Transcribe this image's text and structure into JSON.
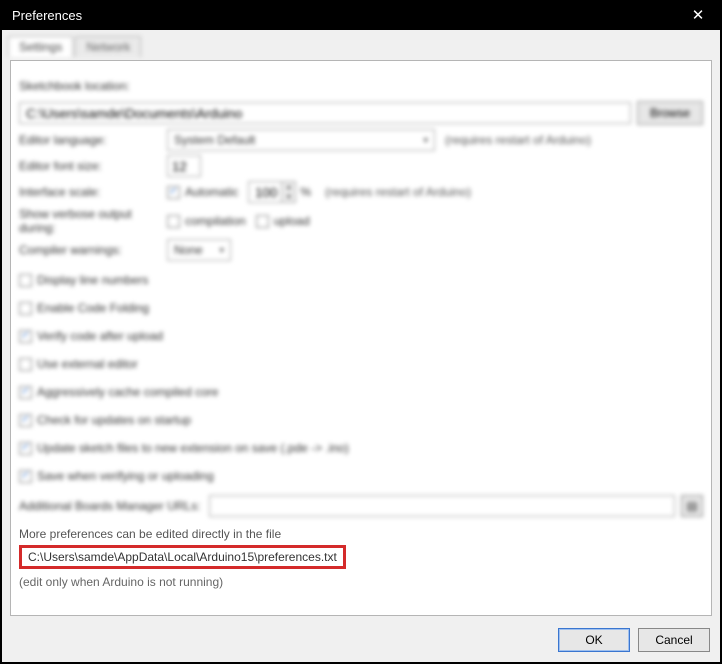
{
  "window": {
    "title": "Preferences"
  },
  "tabs": {
    "active": "Settings",
    "inactive": "Network"
  },
  "fields": {
    "sketchbook_label": "Sketchbook location:",
    "sketchbook_value": "C:\\Users\\samde\\Documents\\Arduino",
    "browse": "Browse",
    "editor_lang_label": "Editor language:",
    "editor_lang_value": "System Default",
    "lang_hint": "(requires restart of Arduino)",
    "font_label": "Editor font size:",
    "font_value": "12",
    "scale_label": "Interface scale:",
    "scale_auto": "Automatic",
    "scale_value": "100",
    "scale_pct": "%",
    "scale_hint": "(requires restart of Arduino)",
    "verbose_label": "Show verbose output during:",
    "verbose_compile": "compilation",
    "verbose_upload": "upload",
    "warnings_label": "Compiler warnings:",
    "warnings_value": "None",
    "boards_label": "Additional Boards Manager URLs:"
  },
  "checks": {
    "line_numbers": {
      "label": "Display line numbers",
      "checked": false
    },
    "code_folding": {
      "label": "Enable Code Folding",
      "checked": false
    },
    "verify_upload": {
      "label": "Verify code after upload",
      "checked": true
    },
    "external_editor": {
      "label": "Use external editor",
      "checked": false
    },
    "cache_core": {
      "label": "Aggressively cache compiled core",
      "checked": true
    },
    "check_updates": {
      "label": "Check for updates on startup",
      "checked": true
    },
    "update_ext": {
      "label": "Update sketch files to new extension on save (.pde -> .ino)",
      "checked": true
    },
    "save_verify": {
      "label": "Save when verifying or uploading",
      "checked": true
    },
    "scale_auto_checked": true,
    "verbose_compile_checked": false,
    "verbose_upload_checked": false
  },
  "footer": {
    "more_line": "More preferences can be edited directly in the file",
    "pref_path": "C:\\Users\\samde\\AppData\\Local\\Arduino15\\preferences.txt",
    "edit_note": "(edit only when Arduino is not running)",
    "ok": "OK",
    "cancel": "Cancel"
  }
}
